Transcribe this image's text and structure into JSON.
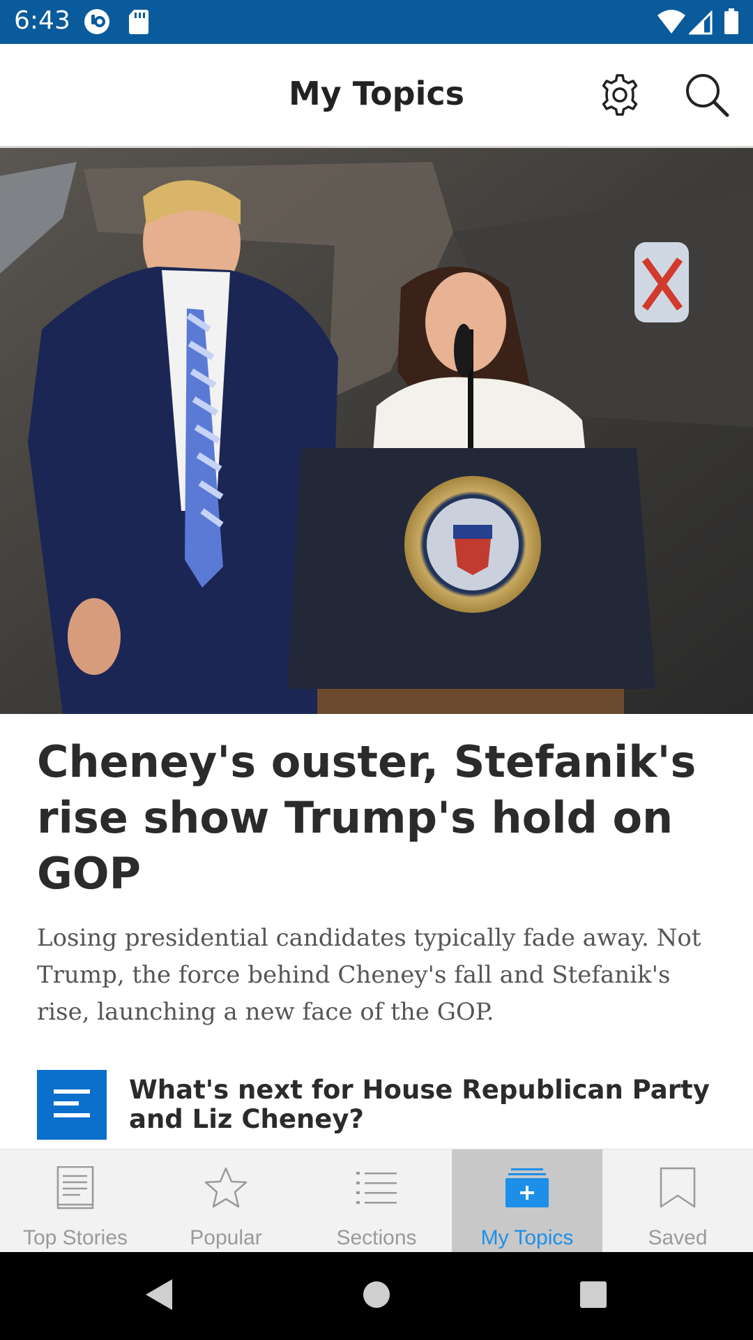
{
  "status_bar": {
    "time": "6:43",
    "icons": [
      "notification-app-icon",
      "sd-card-icon",
      "wifi-icon",
      "signal-icon",
      "battery-icon"
    ]
  },
  "app_bar": {
    "title": "My Topics",
    "settings_icon": "gear-icon",
    "search_icon": "search-icon"
  },
  "article": {
    "image_description_icon": "hero-photo",
    "headline": "Cheney's ouster, Stefanik's rise show Trump's hold on GOP",
    "summary": "Losing presidential candidates typically fade away. Not Trump, the force behind Cheney's fall and Stefanik's rise, launching a new face of the GOP.",
    "related": {
      "icon": "article-list-icon",
      "title": "What's next for House Republican Party and Liz Cheney?"
    }
  },
  "bottom_nav": {
    "tabs": [
      {
        "label": "Top Stories",
        "icon": "newspaper-icon"
      },
      {
        "label": "Popular",
        "icon": "star-icon"
      },
      {
        "label": "Sections",
        "icon": "list-icon"
      },
      {
        "label": "My Topics",
        "icon": "folder-plus-icon",
        "active": true
      },
      {
        "label": "Saved",
        "icon": "bookmark-icon"
      }
    ]
  },
  "colors": {
    "status_bar": "#0a5b9c",
    "accent": "#1e8fe8",
    "badge": "#0b6fcc",
    "active_tab_bg": "#c8c8c8"
  }
}
